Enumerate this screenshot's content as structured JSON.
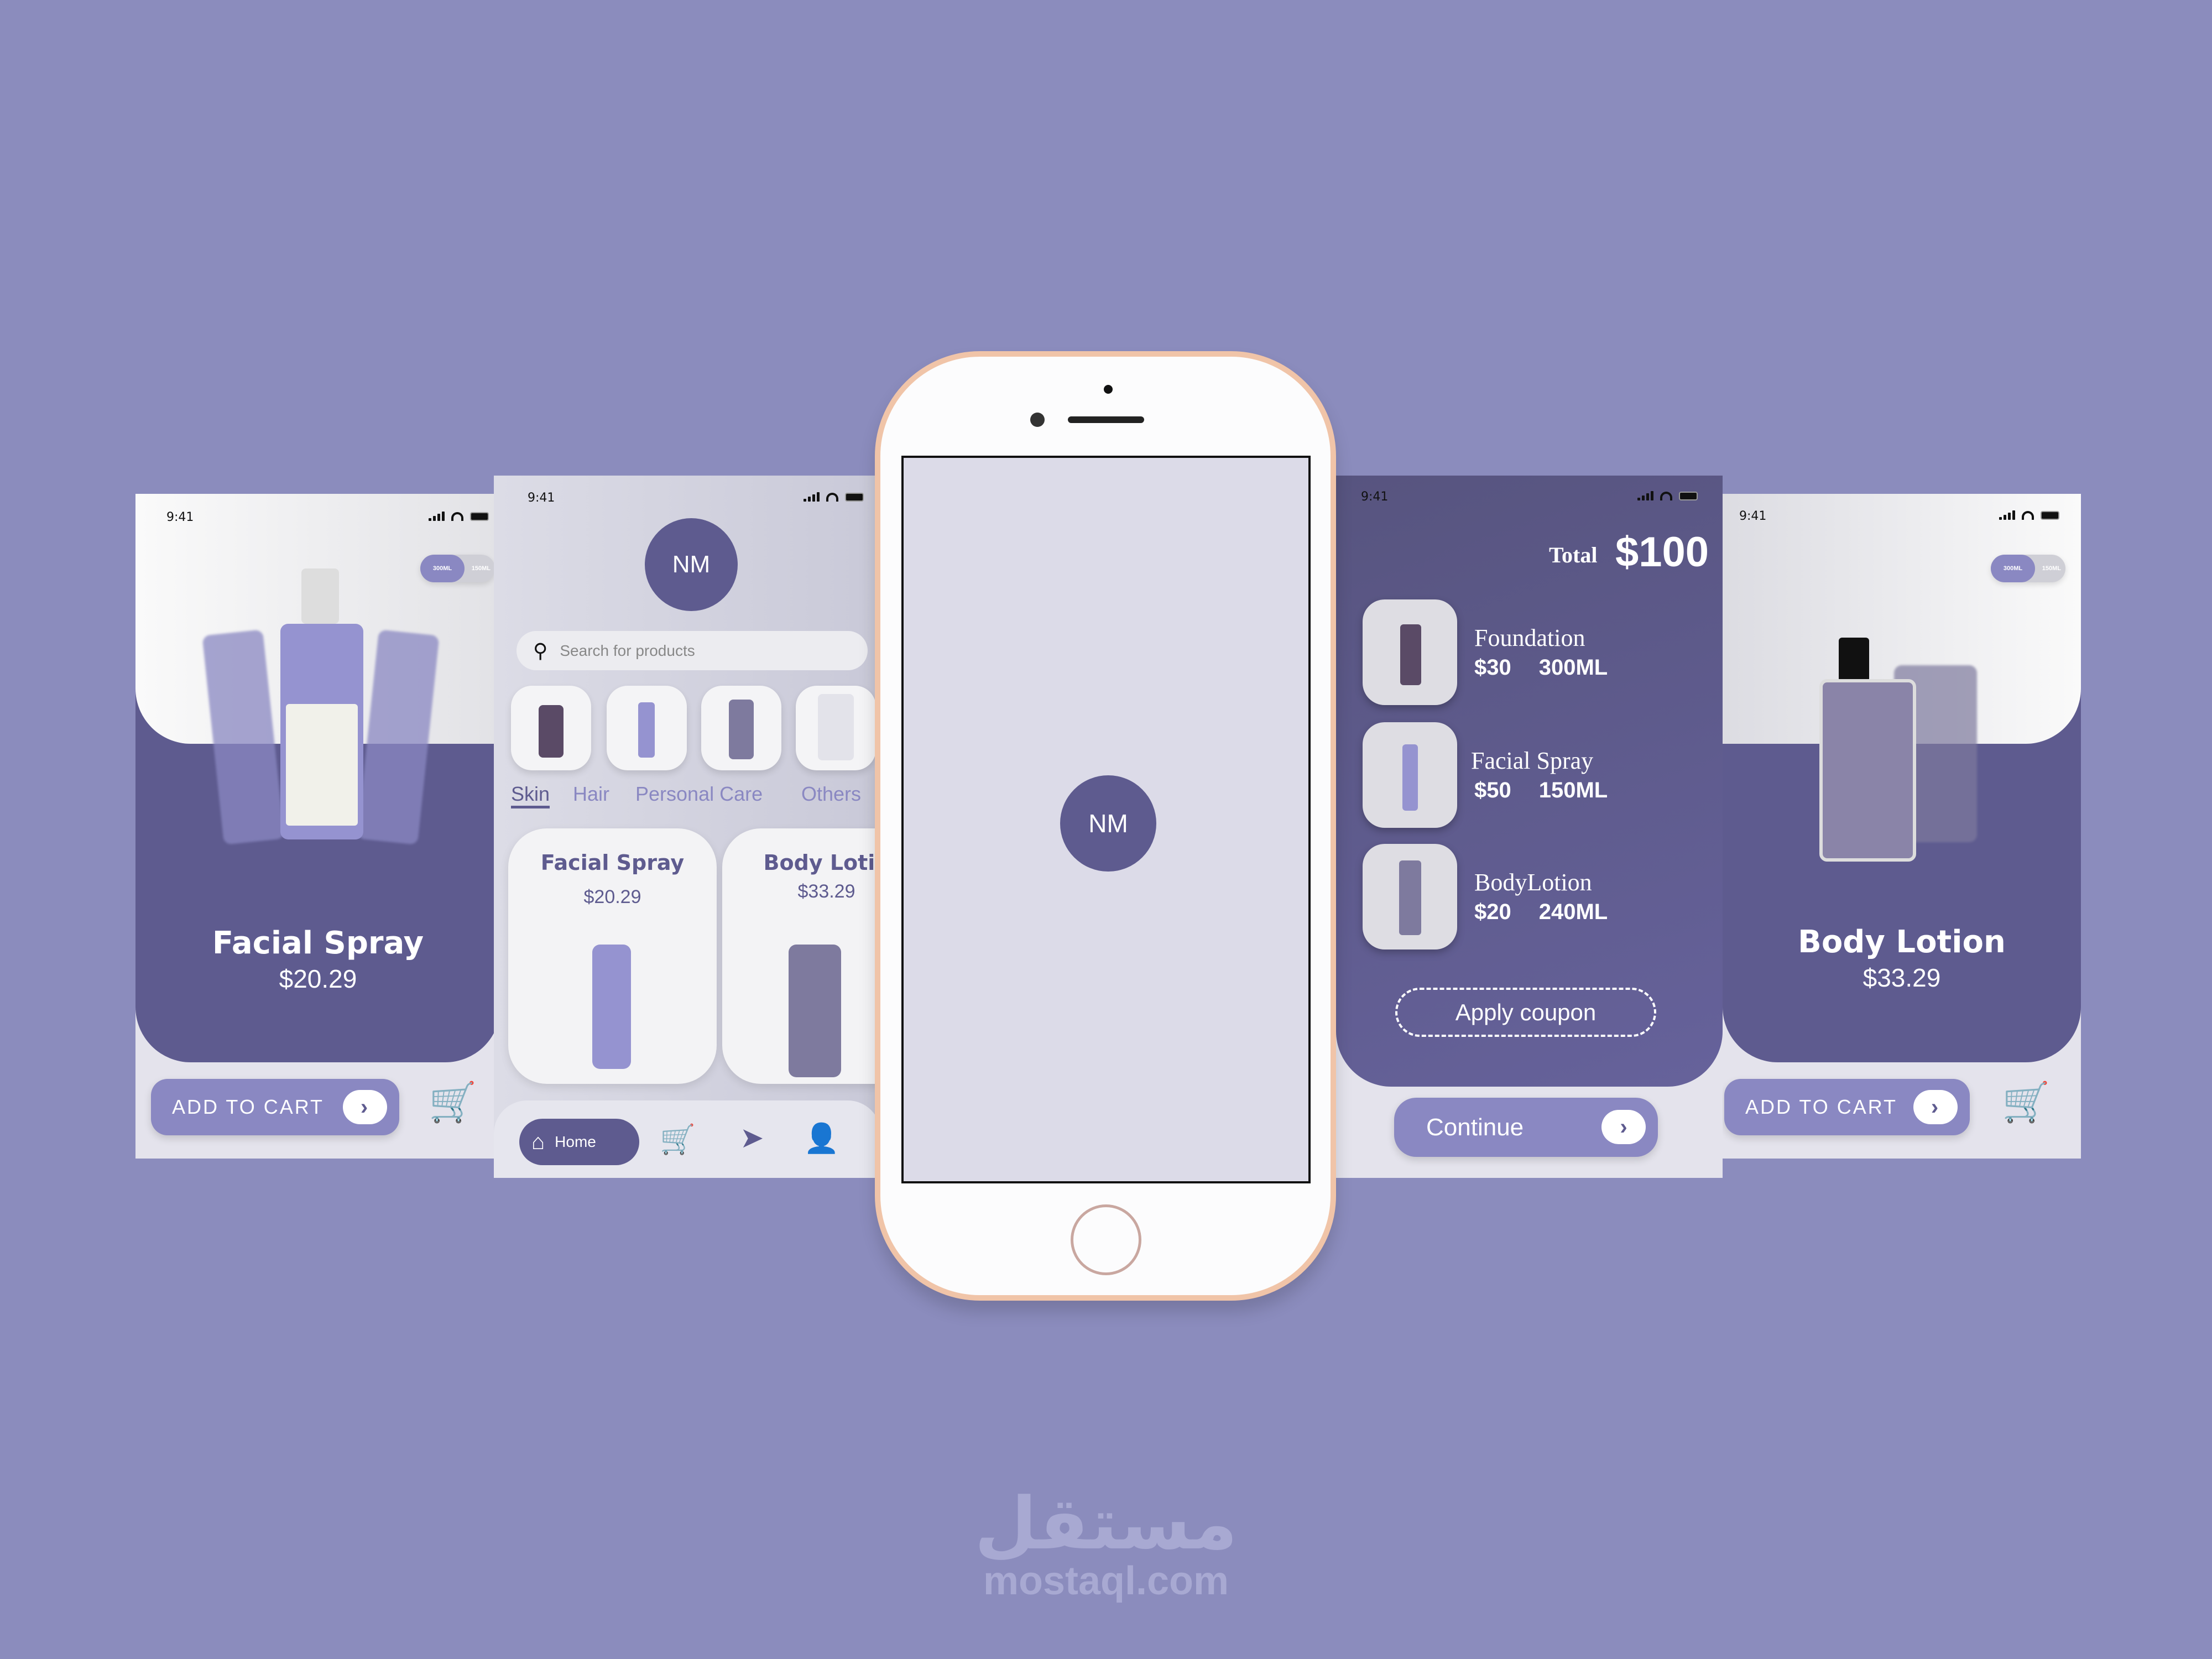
{
  "colors": {
    "background": "#8b8cbd",
    "primary": "#5e5b8f",
    "accent": "#8a88c2",
    "phone_frame": "#f0c4a8"
  },
  "status_bar": {
    "time": "9:41"
  },
  "screen_product_spray": {
    "toggle": {
      "selected": "300ML",
      "other": "150ML"
    },
    "name": "Facial Spray",
    "price": "$20.29",
    "add_to_cart": "ADD TO CART",
    "cart_icon": "cart-icon"
  },
  "screen_home": {
    "avatar": "NM",
    "search": {
      "placeholder": "Search for products"
    },
    "categories": [
      {
        "label": "Skin",
        "active": true
      },
      {
        "label": "Hair"
      },
      {
        "label": "Personal Care"
      },
      {
        "label": "Others"
      }
    ],
    "products": [
      {
        "name": "Facial Spray",
        "price": "$20.29"
      },
      {
        "name": "Body Lotio",
        "price": "$33.29"
      }
    ],
    "nav": {
      "home": "Home",
      "icons": [
        "home-icon",
        "cart-icon",
        "send-icon",
        "user-icon"
      ]
    }
  },
  "phone_splash": {
    "logo": "NM"
  },
  "screen_cart": {
    "total_label": "Total",
    "total_value": "$100",
    "items": [
      {
        "name": "Foundation",
        "price": "$30",
        "size": "300ML"
      },
      {
        "name": "Facial Spray",
        "price": "$50",
        "size": "150ML"
      },
      {
        "name": "BodyLotion",
        "price": "$20",
        "size": "240ML"
      }
    ],
    "coupon": "Apply coupon",
    "continue": "Continue"
  },
  "screen_product_lotion": {
    "toggle": {
      "selected": "300ML",
      "other": "150ML"
    },
    "name": "Body Lotion",
    "price": "$33.29",
    "add_to_cart": "ADD TO CART"
  },
  "watermark": {
    "arabic": "مستقل",
    "latin": "mostaql.com"
  }
}
